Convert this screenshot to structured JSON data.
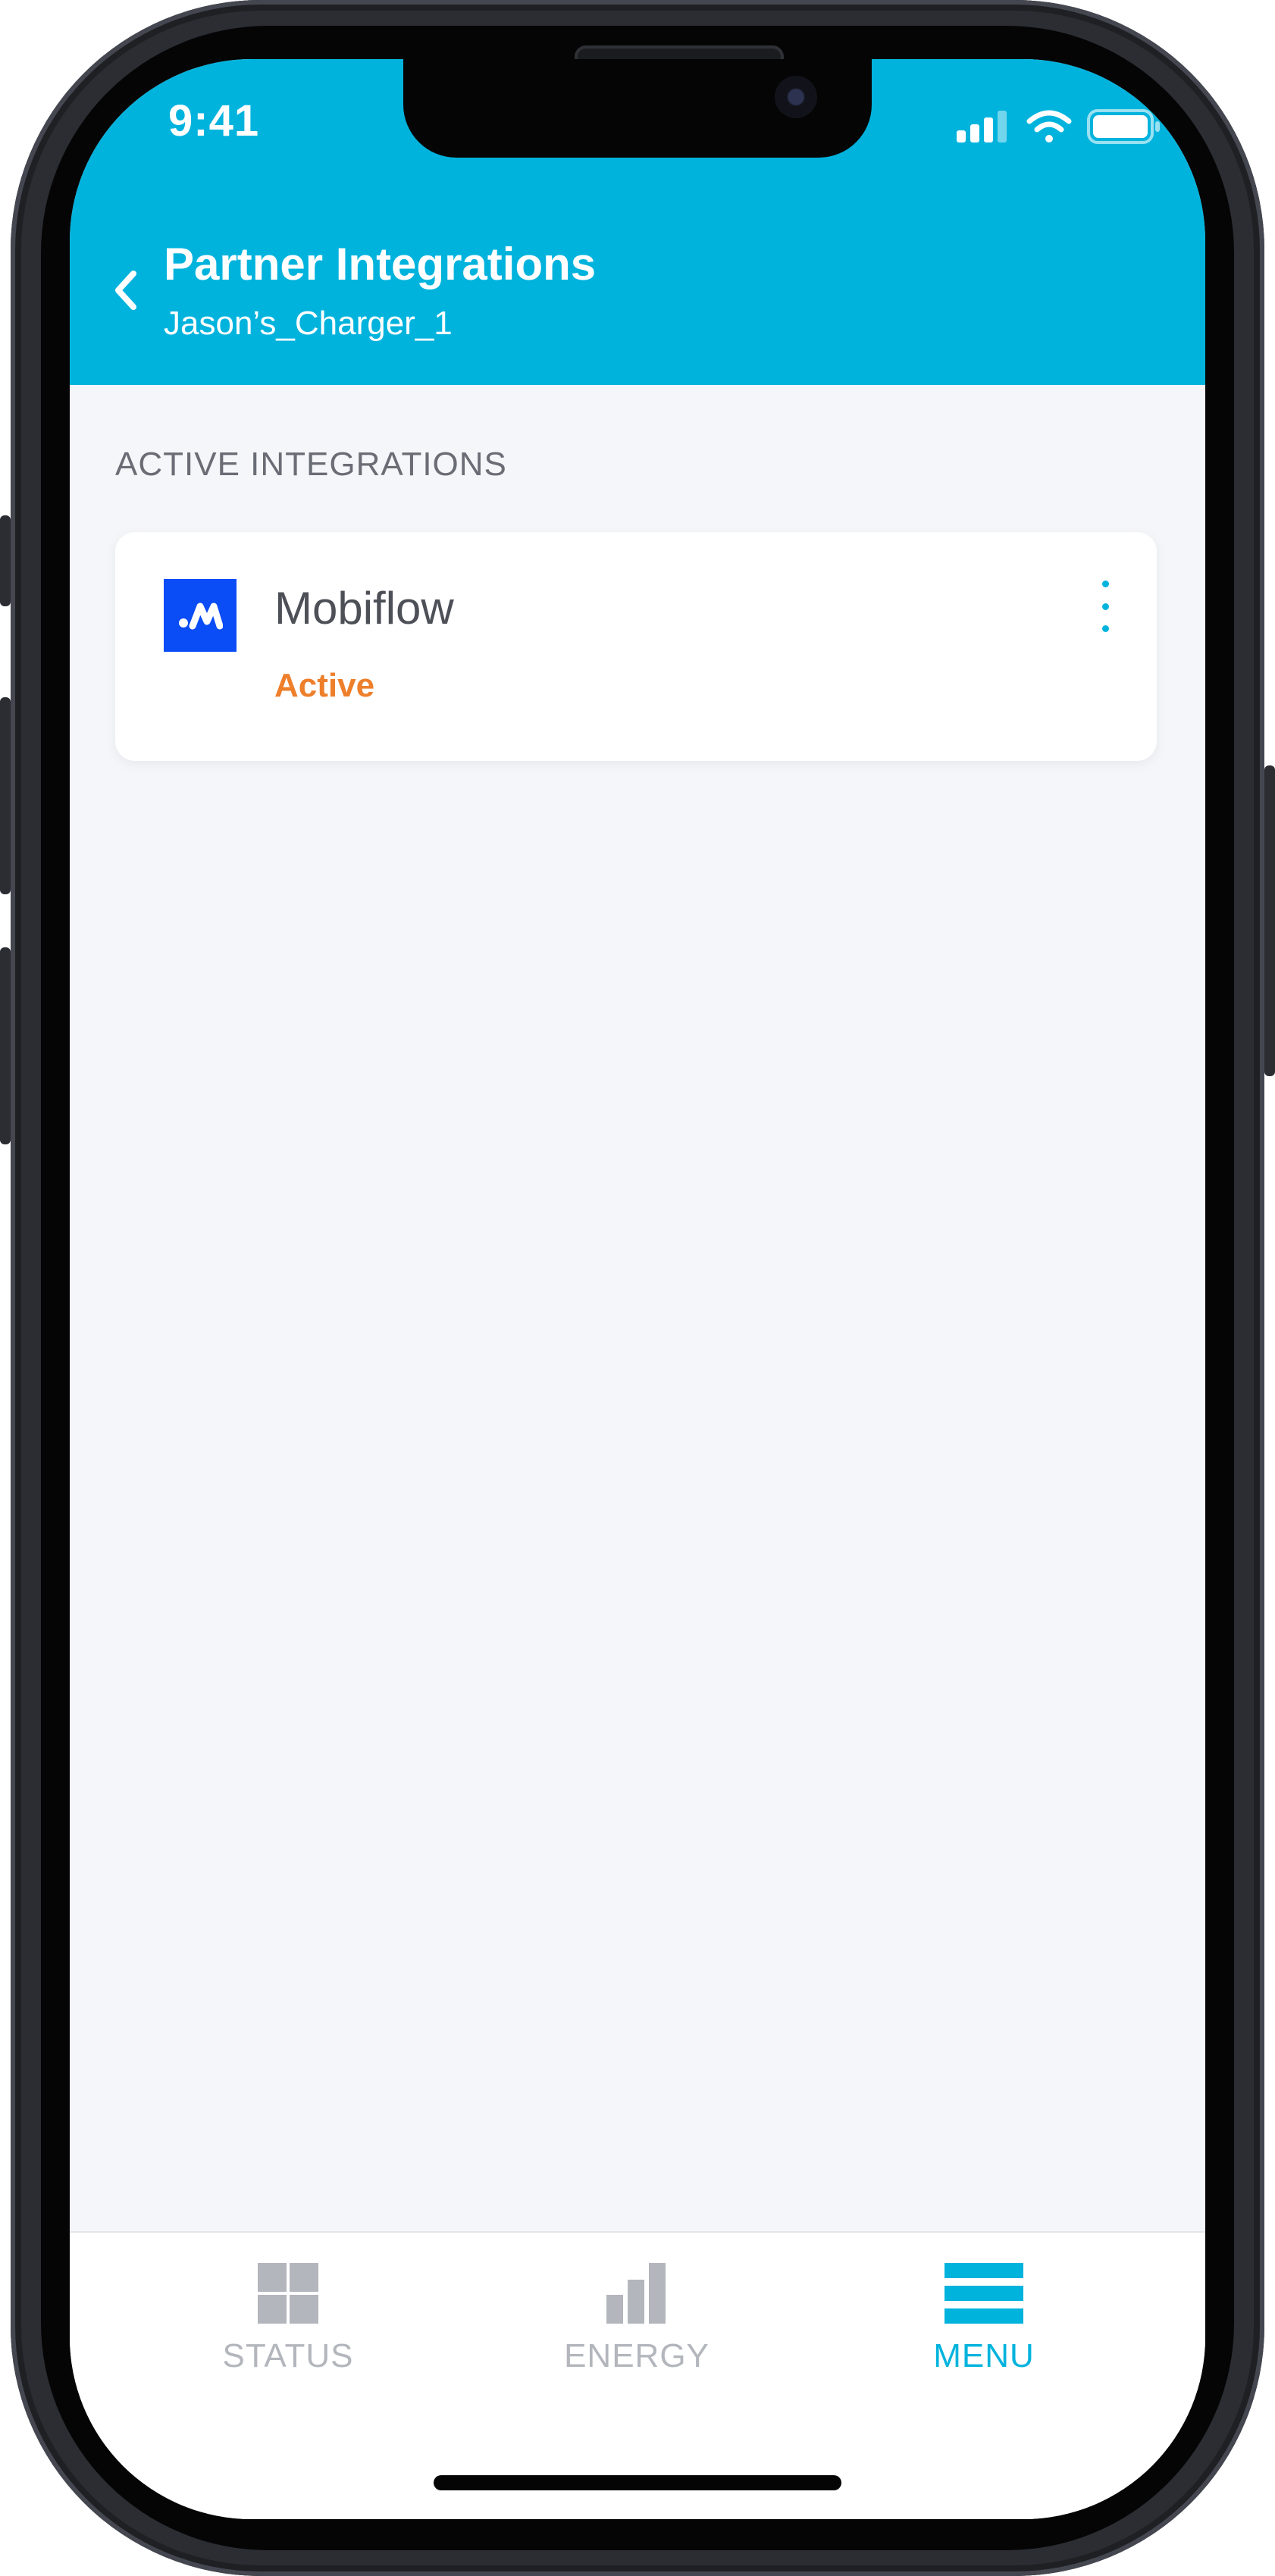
{
  "status_bar": {
    "time": "9:41",
    "icons": [
      "cellular-signal-icon",
      "wifi-icon",
      "battery-icon"
    ]
  },
  "header": {
    "title": "Partner Integrations",
    "subtitle": "Jason’s_Charger_1",
    "back_icon": "chevron-left-icon"
  },
  "section": {
    "label": "ACTIVE INTEGRATIONS"
  },
  "integrations": [
    {
      "name": "Mobiflow",
      "status": "Active",
      "logo_icon": "mobiflow-logo-icon",
      "menu_icon": "more-vertical-icon"
    }
  ],
  "tabbar": {
    "tabs": [
      {
        "label": "STATUS",
        "icon": "grid-icon",
        "selected": false
      },
      {
        "label": "ENERGY",
        "icon": "bar-chart-icon",
        "selected": false
      },
      {
        "label": "MENU",
        "icon": "menu-icon",
        "selected": true
      }
    ]
  },
  "colors": {
    "header_bg": "#00b3dd",
    "accent": "#00b3dd",
    "status_active": "#ee7f2b",
    "logo_bg": "#0a4cf5",
    "tab_inactive": "#b3b6bc",
    "page_bg": "#f5f6f9"
  }
}
